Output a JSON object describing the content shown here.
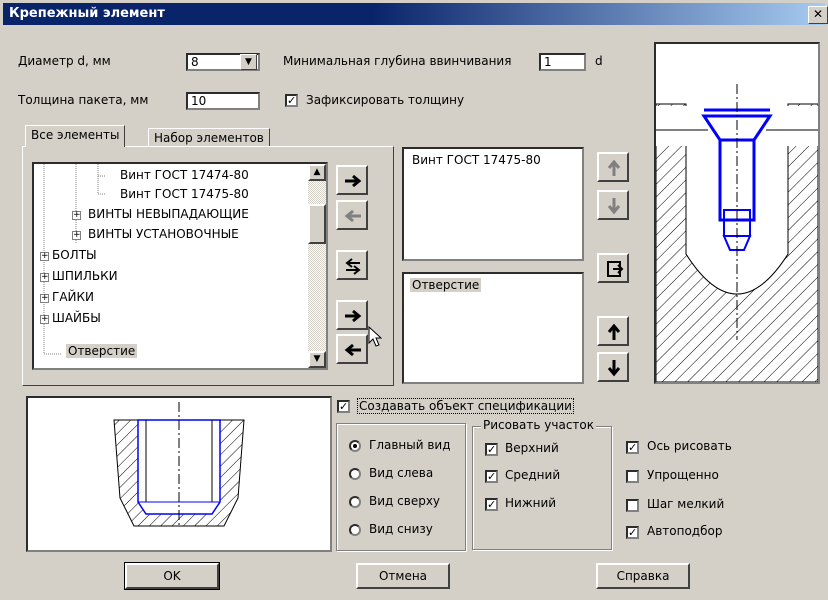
{
  "window": {
    "title": "Крепежный элемент",
    "close_glyph": "✕"
  },
  "diameter": {
    "label": "Диаметр d, мм",
    "value": "8"
  },
  "min_depth": {
    "label": "Минимальная глубина ввинчивания",
    "value": "1",
    "unit": "d"
  },
  "thickness": {
    "label": "Толщина пакета, мм",
    "value": "10"
  },
  "fix_thickness": {
    "label": "Зафиксировать толщину",
    "checked": true
  },
  "tabs": [
    {
      "label": "Все элементы"
    },
    {
      "label": "Набор элементов"
    }
  ],
  "tree": [
    {
      "label": "Винт ГОСТ 17474-80"
    },
    {
      "label": "Винт ГОСТ 17475-80"
    },
    {
      "label": "ВИНТЫ НЕВЫПАДАЮЩИЕ",
      "expander": "+"
    },
    {
      "label": "ВИНТЫ УСТАНОВОЧНЫЕ",
      "expander": "+"
    },
    {
      "label": "БОЛТЫ",
      "expander": "+"
    },
    {
      "label": "ШПИЛЬКИ",
      "expander": "+"
    },
    {
      "label": "ГАЙКИ",
      "expander": "+"
    },
    {
      "label": "ШАЙБЫ",
      "expander": "+"
    },
    {
      "label": "Отверстие"
    }
  ],
  "selected_list_top": {
    "items": [
      "Винт ГОСТ 17475-80"
    ]
  },
  "selected_list_bottom": {
    "items": [
      "Отверстие"
    ]
  },
  "create_spec": {
    "label": "Создавать объект спецификации",
    "checked": true
  },
  "views": {
    "items": [
      {
        "label": "Главный вид",
        "selected": true
      },
      {
        "label": "Вид слева",
        "selected": false
      },
      {
        "label": "Вид сверху",
        "selected": false
      },
      {
        "label": "Вид снизу",
        "selected": false
      }
    ]
  },
  "draw_section": {
    "title": "Рисовать участок",
    "items": [
      {
        "label": "Верхний",
        "checked": true
      },
      {
        "label": "Средний",
        "checked": true
      },
      {
        "label": "Нижний",
        "checked": true
      }
    ]
  },
  "options": {
    "items": [
      {
        "label": "Ось рисовать",
        "checked": true
      },
      {
        "label": "Упрощенно",
        "checked": false
      },
      {
        "label": "Шаг мелкий",
        "checked": false
      },
      {
        "label": "Автоподбор",
        "checked": true
      }
    ]
  },
  "buttons": {
    "ok": "OK",
    "cancel": "Отмена",
    "help": "Справка"
  },
  "colors": {
    "titlebar": "#0a246a",
    "dialog_bg": "#d4d0c8",
    "drawing_blue": "#0000ff"
  }
}
